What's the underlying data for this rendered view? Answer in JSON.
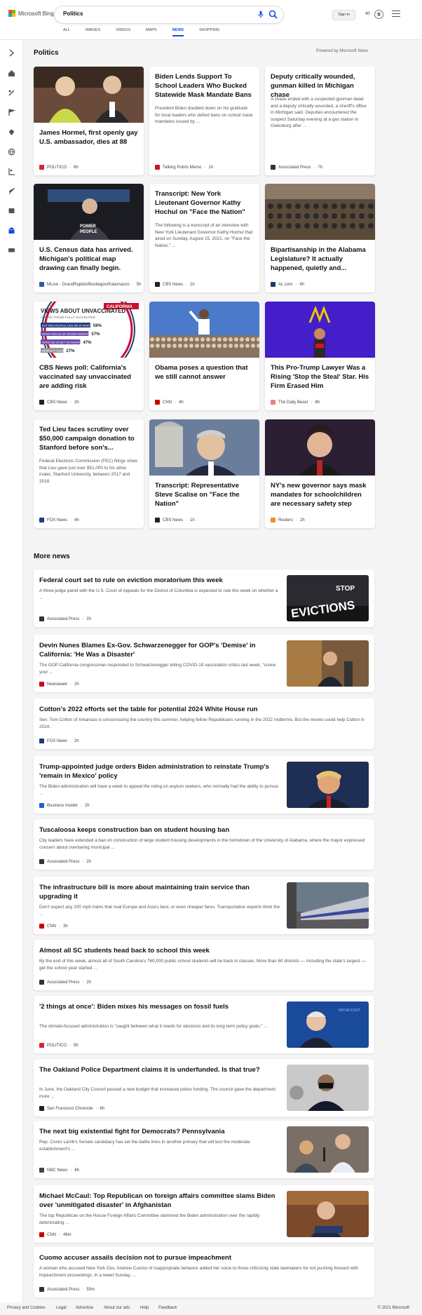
{
  "header": {
    "logo_text": "Microsoft Bing",
    "search_query": "Politics",
    "signin_label": "Sign in",
    "points": "40",
    "tabs": [
      "ALL",
      "IMAGES",
      "VIDEOS",
      "MAPS",
      "NEWS",
      "SHOPPING"
    ],
    "active_tab": "NEWS"
  },
  "sidebar_icons": [
    "expand-icon",
    "home-icon",
    "sports-icon",
    "flag-icon",
    "location-icon",
    "globe-icon",
    "science-icon",
    "rocket-icon",
    "entertainment-icon",
    "politics-icon",
    "money-icon"
  ],
  "section": {
    "title": "Politics",
    "powered_by": "Powered by Microsoft News"
  },
  "cards": [
    {
      "title": "James Hormel, first openly gay U.S. ambassador, dies at 88",
      "desc": "",
      "source": "POLITICO",
      "time": "6h",
      "has_image": true,
      "favicon_color": "#d2282e"
    },
    {
      "title": "Biden Lends Support To School Leaders Who Bucked Statewide Mask Mandate Bans",
      "desc": "President Biden doubled down on his gratitude for local leaders who defied bans on school mask mandates issued by ...",
      "source": "Talking Points Memo",
      "time": "1h",
      "has_image": false,
      "favicon_color": "#c8102e"
    },
    {
      "title": "Deputy critically wounded, gunman killed in Michigan chase",
      "desc": "A chase ended with a suspected gunman dead and a deputy critically wounded, a sheriff's office in Michigan said. Deputies encountered the suspect Saturday evening at a gas station in Galesburg after ...",
      "source": "Associated Press",
      "time": "7h",
      "has_image": false,
      "favicon_color": "#333333"
    },
    {
      "title": "U.S. Census data has arrived. Michigan's political map drawing can finally begin.",
      "desc": "",
      "source": "MLive - GrandRapids/Muskegon/Kalamazoo",
      "time": "5h",
      "has_image": true,
      "favicon_color": "#2a5ca8"
    },
    {
      "title": "Transcript: New York Lieutenant Governor Kathy Hochul on \"Face the Nation\"",
      "desc": "The following is a transcript of an interview with New York Lieutenant Governor Kathy Hochul that aired on Sunday, August 15, 2021, on \"Face the Nation.\" ...",
      "source": "CBS News",
      "time": "1h",
      "has_image": false,
      "favicon_color": "#222222"
    },
    {
      "title": "Bipartisanship in the Alabama Legislature? It actually happened, quietly and...",
      "desc": "",
      "source": "AL.com",
      "time": "4h",
      "has_image": true,
      "favicon_color": "#1d3b6f"
    },
    {
      "title": "CBS News poll: California's vaccinated say unvaccinated are adding risk",
      "desc": "",
      "source": "CBS News",
      "time": "2h",
      "has_image": true,
      "favicon_color": "#222222"
    },
    {
      "title": "Obama poses a question that we still cannot answer",
      "desc": "",
      "source": "CNN",
      "time": "4h",
      "has_image": true,
      "favicon_color": "#cc0000"
    },
    {
      "title": "This Pro-Trump Lawyer Was a Rising 'Stop the Steal' Star. His Firm Erased Him",
      "desc": "",
      "source": "The Daily Beast",
      "time": "8h",
      "has_image": true,
      "favicon_color": "#f08080"
    },
    {
      "title": "Ted Lieu faces scrutiny over $50,000 campaign donation to Stanford before son's...",
      "desc": "Federal Elections Commission (FEC) filings show that Lieu gave just over $51,000 to his alma mater, Stanford University, between 2017 and 2018.",
      "source": "FOX News",
      "time": "4h",
      "has_image": false,
      "favicon_color": "#1f3d7a"
    },
    {
      "title": "Transcript: Representative Steve Scalise on \"Face the Nation\"",
      "desc": "",
      "source": "CBS News",
      "time": "1h",
      "has_image": true,
      "favicon_color": "#222222"
    },
    {
      "title": "NY's new governor says mask mandates for schoolchildren are necessary safety step",
      "desc": "",
      "source": "Reuters",
      "time": "2h",
      "has_image": true,
      "favicon_color": "#f28c28"
    }
  ],
  "poll_graphic": {
    "brand": "CALIFORNIA",
    "heading": "VIEWS ABOUT UNVACCINATED",
    "subheading": "AMONG THOSE FULLY VACCINATED",
    "rows": [
      {
        "label": "PUTTING PEOPLE LIKE ME AT RISK",
        "value": "59%",
        "pct": 0.59
      },
      {
        "label": "BEING MISLED BY MISINFORMATION",
        "value": "57%",
        "pct": 0.57
      },
      {
        "label": "MAKE ME UPSET OR ANGRY",
        "value": "47%",
        "pct": 0.47
      },
      {
        "label": "RESPECT THEIR DECISION",
        "value": "27%",
        "pct": 0.27
      }
    ]
  },
  "more_news": {
    "title": "More news",
    "items": [
      {
        "title": "Federal court set to rule on eviction moratorium this week",
        "desc": "A three-judge panel with the U.S. Court of Appeals for the District of Columbia is expected to rule this week on whether a ...",
        "source": "Associated Press",
        "time": "2h",
        "thumb": "evictions",
        "favicon_color": "#333333"
      },
      {
        "title": "Devin Nunes Blames Ex-Gov. Schwarzenegger for GOP's 'Demise' in California: 'He Was a Disaster'",
        "desc": "The GOP California congressman responded to Schwarzenegger telling COVID-19 vaccination critics last week, \"screw your ...",
        "source": "Newsweek",
        "time": "2h",
        "thumb": "nunes",
        "favicon_color": "#d0021b"
      },
      {
        "title": "Cotton's 2022 efforts set the table for potential 2024 White House run",
        "desc": "Sen. Tom Cotton of Arkansas is crisscrossing the country this summer, helping fellow Republicans running in the 2022 midterms. But the moves could help Cotton in 2024.",
        "source": "FOX News",
        "time": "2h",
        "thumb": "",
        "favicon_color": "#1f3d7a"
      },
      {
        "title": "Trump-appointed judge orders Biden administration to reinstate Trump's 'remain in Mexico' policy",
        "desc": "The Biden administration will have a week to appeal the ruling on asylum seekers, who normally had the ability to pursue ...",
        "source": "Business Insider",
        "time": "2h",
        "thumb": "trump",
        "favicon_color": "#1e5bd6"
      },
      {
        "title": "Tuscaloosa keeps construction ban on student housing ban",
        "desc": "City leaders have extended a ban on construction of large student housing developments in the hometown of the University of Alabama, where the mayor expressed concern about overtaxing municipal ...",
        "source": "Associated Press",
        "time": "2h",
        "thumb": "",
        "favicon_color": "#333333"
      },
      {
        "title": "The infrastructure bill is more about maintaining train service than upgrading it",
        "desc": "Don't expect any 200 mph trains that rival Europe and Asia's best, or even cheaper fares. Transportation experts think the ...",
        "source": "CNN",
        "time": "3h",
        "thumb": "train",
        "favicon_color": "#cc0000"
      },
      {
        "title": "Almost all SC students head back to school this week",
        "desc": "By the end of this week, almost all of South Carolina's 760,000 public school students will be back in classes. More than 60 districts — including the state's largest — get the school year started ...",
        "source": "Associated Press",
        "time": "2h",
        "thumb": "",
        "favicon_color": "#333333"
      },
      {
        "title": "'2 things at once': Biden mixes his messages on fossil fuels",
        "desc": "The climate-focused administration is \"caught between what it needs for elections and its long term policy goals.\" ...",
        "source": "POLITICO",
        "time": "5h",
        "thumb": "biden",
        "favicon_color": "#d2282e"
      },
      {
        "title": "The Oakland Police Department claims it is underfunded. Is that true?",
        "desc": "In June, the Oakland City Council passed a new budget that increased police funding. The council gave the department more ...",
        "source": "San Francisco Chronicle",
        "time": "6h",
        "thumb": "police",
        "favicon_color": "#222222"
      },
      {
        "title": "The next big existential fight for Democrats? Pennsylvania",
        "desc": "Rep. Conor Lamb's Senate candidacy has set the battle lines in another primary that will test the moderate establishment's ...",
        "source": "NBC News",
        "time": "8h",
        "thumb": "lamb",
        "favicon_color": "#444444"
      },
      {
        "title": "Michael McCaul: Top Republican on foreign affairs committee slams Biden over 'unmitigated disaster' in Afghanistan",
        "desc": "The top Republican on the House Foreign Affairs Committee slammed the Biden administration over the rapidly deteriorating ...",
        "source": "CNN",
        "time": "46m",
        "thumb": "mccaul",
        "favicon_color": "#cc0000"
      },
      {
        "title": "Cuomo accuser assails decision not to pursue impeachment",
        "desc": "A woman who accused New York Gov. Andrew Cuomo of inappropriate behavior added her voice to those criticizing state lawmakers for not pushing forward with impeachment proceedings. In a tweet Sunday, ...",
        "source": "Associated Press",
        "time": "50m",
        "thumb": "",
        "favicon_color": "#333333"
      }
    ]
  },
  "thumb_text": {
    "evictions": "EVICTIONS",
    "stop": "STOP",
    "broadcast": "BROADCAST"
  },
  "footer": {
    "links": [
      "Privacy and Cookies",
      "Legal",
      "Advertise",
      "About our ads",
      "Help",
      "Feedback"
    ],
    "copyright": "© 2021 Microsoft"
  }
}
